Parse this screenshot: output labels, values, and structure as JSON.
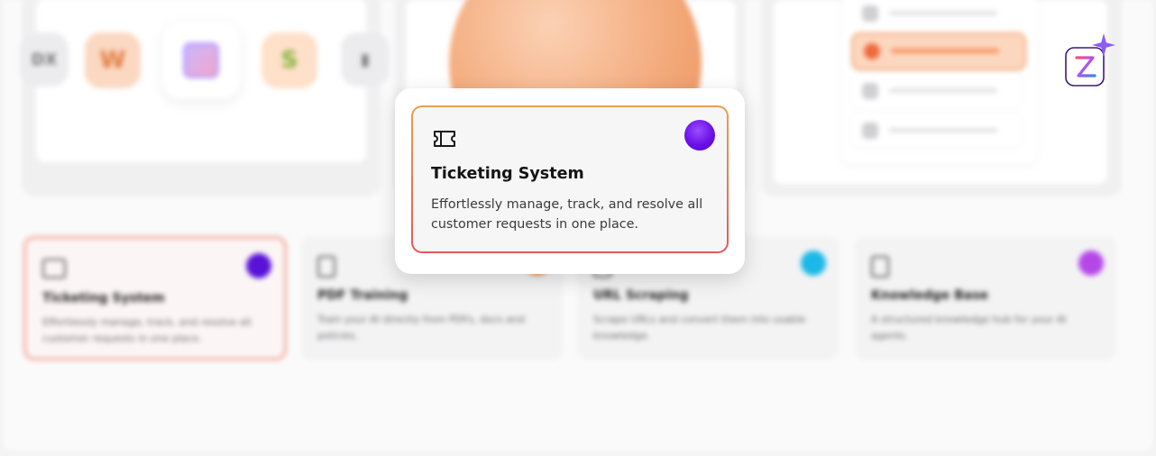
{
  "popup": {
    "icon": "ticket-icon",
    "accent_dot_color": "#6a11e6",
    "title": "Ticketing System",
    "description": "Effortlessly manage, track, and resolve all customer requests in one place."
  },
  "integrations": {
    "nodes": [
      {
        "icon": "text-icon",
        "label": "DX"
      },
      {
        "icon": "wordpress-icon",
        "label": "W"
      },
      {
        "icon": "app-hub-icon",
        "label": ""
      },
      {
        "icon": "shopify-icon",
        "label": "S"
      },
      {
        "icon": "device-icon",
        "label": "▮"
      }
    ]
  },
  "feature_cards": [
    {
      "title": "Ticketing System",
      "description": "Effortlessly manage, track, and resolve all customer requests in one place.",
      "dot_color": "#5a12d8",
      "selected": true
    },
    {
      "title": "PDF Training",
      "description": "Train your AI directly from PDFs, docs and policies.",
      "dot_color": "#f39a5a",
      "selected": false
    },
    {
      "title": "URL Scraping",
      "description": "Scrape URLs and convert them into usable knowledge.",
      "dot_color": "#1cb8e8",
      "selected": false
    },
    {
      "title": "Knowledge Base",
      "description": "A structured knowledge hub for your AI agents.",
      "dot_color": "#b547e8",
      "selected": false
    }
  ],
  "brand": {
    "logo_icon": "sparkle-logo-icon",
    "accent": "#7c3aed"
  }
}
